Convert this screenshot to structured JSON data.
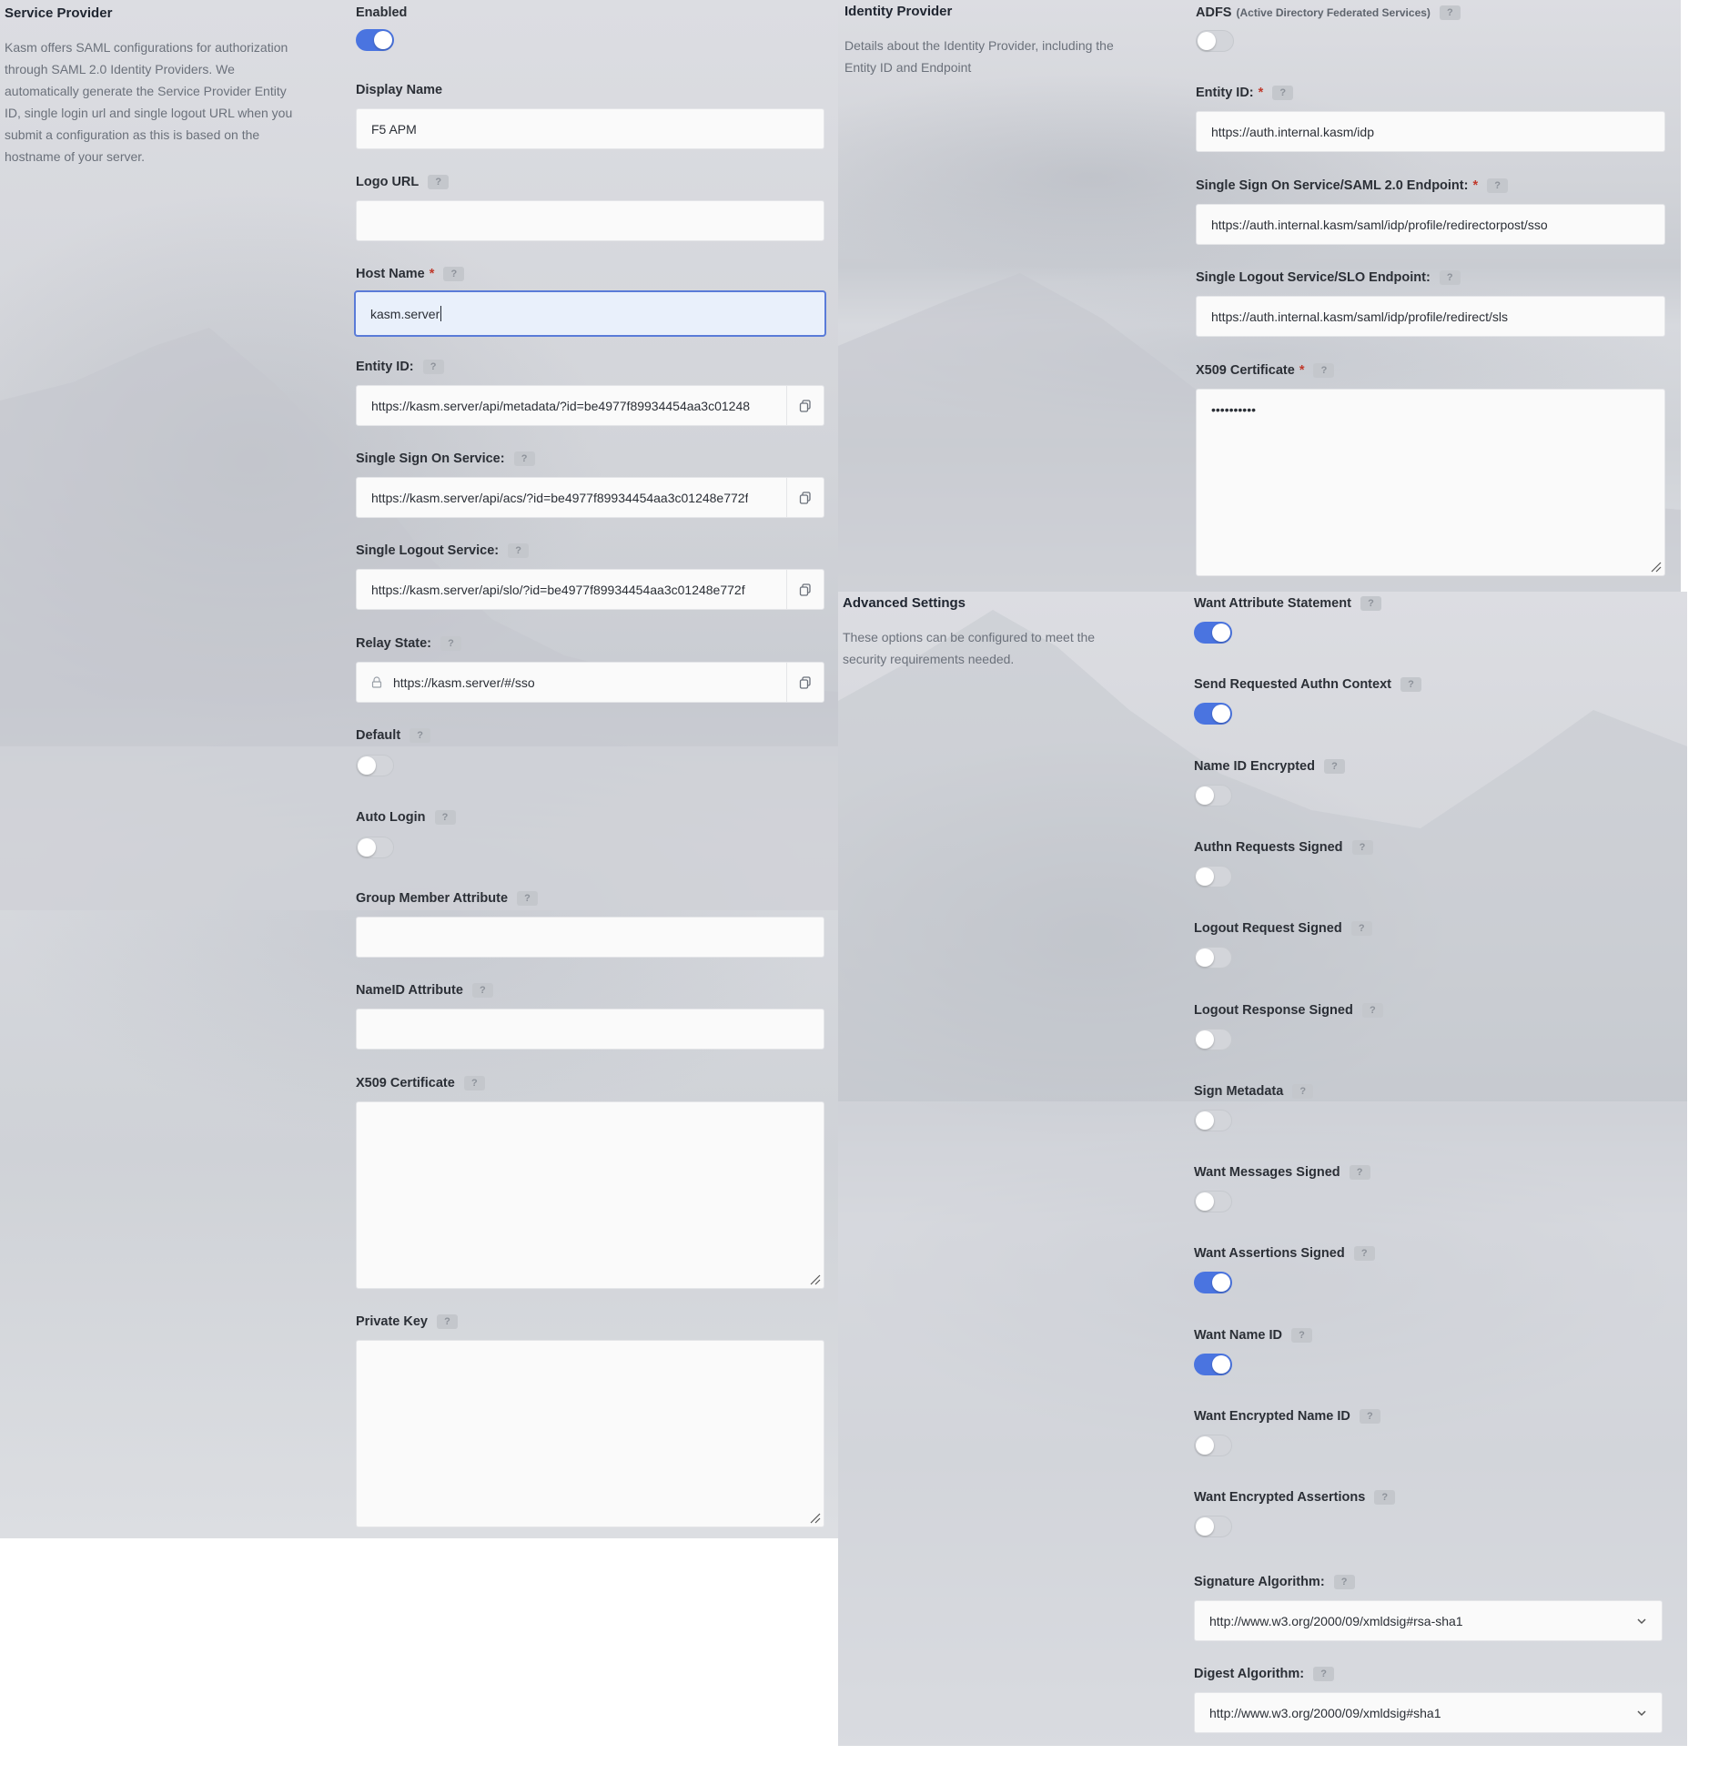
{
  "service_provider": {
    "title": "Service Provider",
    "description": "Kasm offers SAML configurations for authorization through SAML 2.0 Identity Providers. We automatically generate the Service Provider Entity ID, single login url and single logout URL when you submit a configuration as this is based on the hostname of your server.",
    "enabled": {
      "label": "Enabled",
      "on": true
    },
    "display_name": {
      "label": "Display Name",
      "value": "F5 APM"
    },
    "logo_url": {
      "label": "Logo URL",
      "value": ""
    },
    "host_name": {
      "label": "Host Name",
      "value": "kasm.server"
    },
    "entity_id": {
      "label": "Entity ID:",
      "value": "https://kasm.server/api/metadata/?id=be4977f89934454aa3c01248"
    },
    "sso_service": {
      "label": "Single Sign On Service:",
      "value": "https://kasm.server/api/acs/?id=be4977f89934454aa3c01248e772f"
    },
    "slo_service": {
      "label": "Single Logout Service:",
      "value": "https://kasm.server/api/slo/?id=be4977f89934454aa3c01248e772f"
    },
    "relay_state": {
      "label": "Relay State:",
      "value": "https://kasm.server/#/sso"
    },
    "default": {
      "label": "Default",
      "on": false
    },
    "auto_login": {
      "label": "Auto Login",
      "on": false
    },
    "group_member_attribute": {
      "label": "Group Member Attribute",
      "value": ""
    },
    "nameid_attribute": {
      "label": "NameID Attribute",
      "value": ""
    },
    "x509": {
      "label": "X509 Certificate",
      "value": ""
    },
    "private_key": {
      "label": "Private Key",
      "value": ""
    }
  },
  "identity_provider": {
    "title": "Identity Provider",
    "description": "Details about the Identity Provider, including the Entity ID and Endpoint",
    "adfs": {
      "label": "ADFS",
      "sub": "(Active Directory Federated Services)",
      "on": false
    },
    "entity_id": {
      "label": "Entity ID:",
      "value": "https://auth.internal.kasm/idp"
    },
    "sso_endpoint": {
      "label": "Single Sign On Service/SAML 2.0 Endpoint:",
      "value": "https://auth.internal.kasm/saml/idp/profile/redirectorpost/sso"
    },
    "slo_endpoint": {
      "label": "Single Logout Service/SLO Endpoint:",
      "value": "https://auth.internal.kasm/saml/idp/profile/redirect/sls"
    },
    "x509": {
      "label": "X509 Certificate",
      "value": "••••••••••"
    }
  },
  "advanced": {
    "title": "Advanced Settings",
    "description": "These options can be configured to meet the security requirements needed.",
    "toggles": [
      {
        "label": "Want Attribute Statement",
        "on": true
      },
      {
        "label": "Send Requested Authn Context",
        "on": true
      },
      {
        "label": "Name ID Encrypted",
        "on": false
      },
      {
        "label": "Authn Requests Signed",
        "on": false
      },
      {
        "label": "Logout Request Signed",
        "on": false
      },
      {
        "label": "Logout Response Signed",
        "on": false
      },
      {
        "label": "Sign Metadata",
        "on": false
      },
      {
        "label": "Want Messages Signed",
        "on": false
      },
      {
        "label": "Want Assertions Signed",
        "on": true
      },
      {
        "label": "Want Name ID",
        "on": true
      },
      {
        "label": "Want Encrypted Name ID",
        "on": false
      },
      {
        "label": "Want Encrypted Assertions",
        "on": false
      }
    ],
    "signature_algorithm": {
      "label": "Signature Algorithm:",
      "value": "http://www.w3.org/2000/09/xmldsig#rsa-sha1"
    },
    "digest_algorithm": {
      "label": "Digest Algorithm:",
      "value": "http://www.w3.org/2000/09/xmldsig#sha1"
    }
  },
  "common": {
    "help_glyph": "?",
    "required_mark": "*"
  },
  "icons": {
    "copy": "copy-icon",
    "lock": "lock-icon",
    "chevron": "chevron-down-icon",
    "resize": "resize-handle-icon"
  },
  "colors": {
    "accent": "#4a74e0",
    "required": "#c0392b",
    "focus_border": "#5a7bd8"
  }
}
